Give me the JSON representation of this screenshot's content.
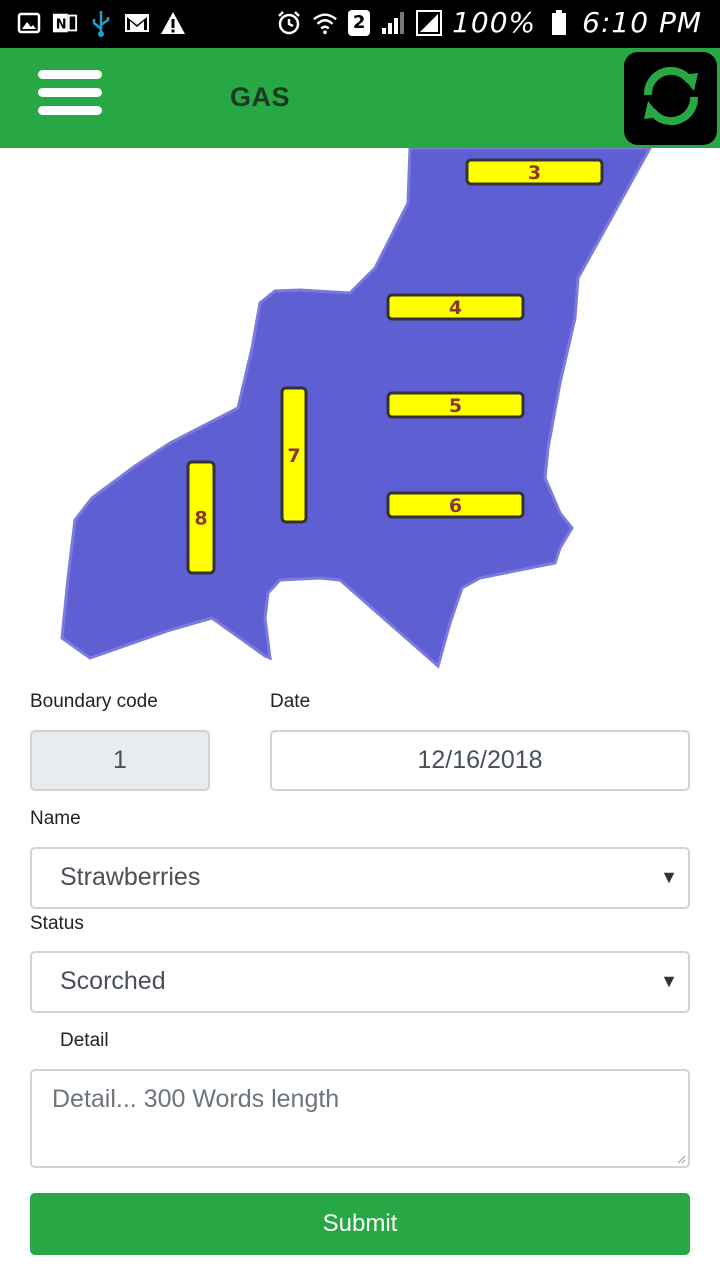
{
  "status_bar": {
    "battery": "100%",
    "time": "6:10 PM",
    "sim_badge": "2",
    "icons": [
      "gallery-icon",
      "onenote-icon",
      "usb-icon",
      "gmail-icon",
      "warning-icon",
      "alarm-icon",
      "wifi-icon",
      "signal-icon",
      "battery-icon"
    ]
  },
  "app_bar": {
    "title": "GAS",
    "menu_icon": "hamburger-icon",
    "refresh_icon": "refresh-icon",
    "accent": "#28a745"
  },
  "map": {
    "region_color": "#5f5fd4",
    "plot_color": "#ffff00",
    "plots": [
      {
        "label": "3"
      },
      {
        "label": "4"
      },
      {
        "label": "5"
      },
      {
        "label": "6"
      },
      {
        "label": "7"
      },
      {
        "label": "8"
      }
    ]
  },
  "form": {
    "boundary_label": "Boundary code",
    "boundary_value": "1",
    "date_label": "Date",
    "date_value": "12/16/2018",
    "name_label": "Name",
    "name_value": "Strawberries",
    "status_label": "Status",
    "status_value": "Scorched",
    "detail_label": "Detail",
    "detail_placeholder": "Detail... 300 Words length",
    "submit_label": "Submit"
  }
}
